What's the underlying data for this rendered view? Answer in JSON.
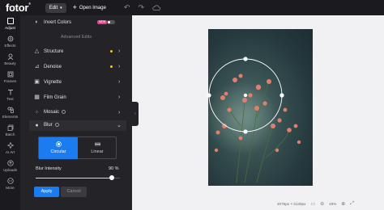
{
  "topbar": {
    "logo": "fotor",
    "logo_mark": "®",
    "edit_label": "Edit",
    "open_image_label": "Open Image",
    "icons": [
      "undo-icon",
      "redo-icon",
      "cloud-icon"
    ]
  },
  "rail": {
    "items": [
      {
        "label": "Adjust",
        "icon": "sliders-icon"
      },
      {
        "label": "Effects",
        "icon": "effects-icon"
      },
      {
        "label": "Beauty",
        "icon": "beauty-icon"
      },
      {
        "label": "Frames",
        "icon": "frame-icon"
      },
      {
        "label": "Text",
        "icon": "text-icon"
      },
      {
        "label": "Elements",
        "icon": "elements-icon"
      },
      {
        "label": "Batch",
        "icon": "batch-icon"
      },
      {
        "label": "AI Art",
        "icon": "ai-art-icon"
      },
      {
        "label": "Uploads",
        "icon": "upload-icon"
      },
      {
        "label": "More",
        "icon": "more-icon"
      }
    ]
  },
  "panel": {
    "invert_label": "Invert Colors",
    "new_badge": "NEW",
    "section_title": "Advanced Edits",
    "tools": [
      {
        "label": "Structure",
        "icon": "triangle-icon",
        "dot": true
      },
      {
        "label": "Denoise",
        "icon": "denoise-icon",
        "dot": true
      },
      {
        "label": "Vignette",
        "icon": "vignette-icon",
        "dot": false
      },
      {
        "label": "Film Grain",
        "icon": "grain-icon",
        "dot": false
      },
      {
        "label": "Mosaic",
        "icon": "mosaic-icon",
        "dot": false
      }
    ],
    "blur": {
      "label": "Blur",
      "modes": [
        {
          "label": "Circular",
          "icon": "circular-icon",
          "selected": true
        },
        {
          "label": "Linear",
          "icon": "linear-icon",
          "selected": false
        }
      ],
      "intensity_label": "Blur Intensity",
      "intensity_value": "90",
      "intensity_unit": "%",
      "intensity_fraction": 0.9
    },
    "apply_label": "Apply",
    "cancel_label": "Cancel"
  },
  "status": {
    "dimensions": "2075px × 3130px",
    "zoom": "19%"
  },
  "colors": {
    "accent": "#1a7cf0",
    "dot": "#f5c518",
    "panel": "#232328"
  }
}
